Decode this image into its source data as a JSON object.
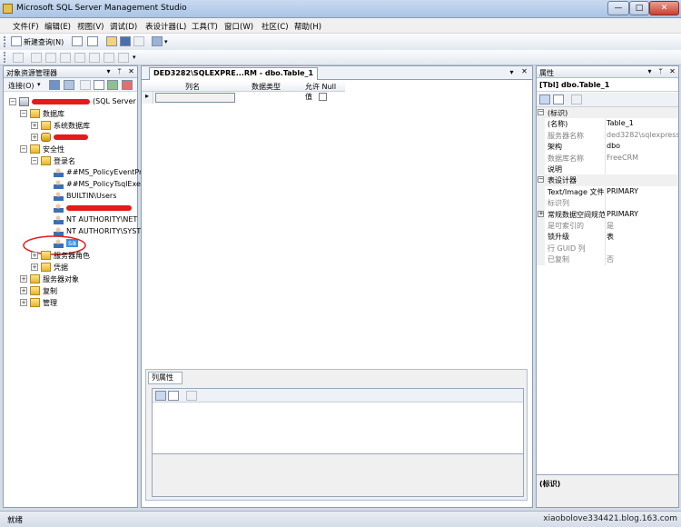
{
  "window": {
    "title": "Microsoft SQL Server Management Studio",
    "minimize": "—",
    "maximize": "□",
    "close": "✕"
  },
  "menu": [
    "文件(F)",
    "编辑(E)",
    "视图(V)",
    "调试(D)",
    "表设计器(L)",
    "工具(T)",
    "窗口(W)",
    "社区(C)",
    "帮助(H)"
  ],
  "toolbar": {
    "new_query": "新建查询(N)"
  },
  "object_explorer": {
    "title": "对象资源管理器",
    "connect": "连接(O)",
    "server_suffix": "(SQL Server",
    "tree": {
      "databases": "数据库",
      "system_databases": "系统数据库",
      "security": "安全性",
      "logins": "登录名",
      "login_items": [
        "##MS_PolicyEventPro",
        "##MS_PolicyTsqlExec",
        "BUILTIN\\Users",
        "NT AUTHORITY\\NET",
        "NT AUTHORITY\\SYST"
      ],
      "selected_login": "sa",
      "server_roles": "服务器角色",
      "credentials": "凭据",
      "server_objects": "服务器对象",
      "replication": "复制",
      "management": "管理"
    }
  },
  "designer": {
    "tab_title": "DED3282\\SQLEXPRE...RM - dbo.Table_1",
    "columns": [
      "列名",
      "数据类型",
      "允许 Null 值"
    ],
    "row_marker": "▸",
    "column_properties_tab": "列属性"
  },
  "properties": {
    "title": "属性",
    "object": "[Tbl] dbo.Table_1",
    "rows": [
      {
        "name": "(标识)",
        "value": "",
        "kind": "cat"
      },
      {
        "name": "(名称)",
        "value": "Table_1",
        "kind": "rw"
      },
      {
        "name": "服务器名称",
        "value": "ded3282\\sqlexpress",
        "kind": "ro"
      },
      {
        "name": "架构",
        "value": "dbo",
        "kind": "rw"
      },
      {
        "name": "数据库名称",
        "value": "FreeCRM",
        "kind": "ro"
      },
      {
        "name": "说明",
        "value": "",
        "kind": "rw"
      },
      {
        "name": "表设计器",
        "value": "",
        "kind": "cat"
      },
      {
        "name": "Text/Image 文件组",
        "value": "PRIMARY",
        "kind": "rw"
      },
      {
        "name": "标识列",
        "value": "",
        "kind": "ro"
      },
      {
        "name": "常规数据空间规范",
        "value": "PRIMARY",
        "kind": "sub"
      },
      {
        "name": "是可索引的",
        "value": "是",
        "kind": "ro"
      },
      {
        "name": "锁升级",
        "value": "表",
        "kind": "rw"
      },
      {
        "name": "行 GUID 列",
        "value": "",
        "kind": "ro"
      },
      {
        "name": "已复制",
        "value": "否",
        "kind": "ro"
      }
    ],
    "description_label": "(标识)"
  },
  "status": {
    "text": "就绪",
    "watermark": "xiaobolove334421.blog.163.com"
  },
  "colors": {
    "redaction": "#e51a1a",
    "accent": "#3a6fb5"
  }
}
